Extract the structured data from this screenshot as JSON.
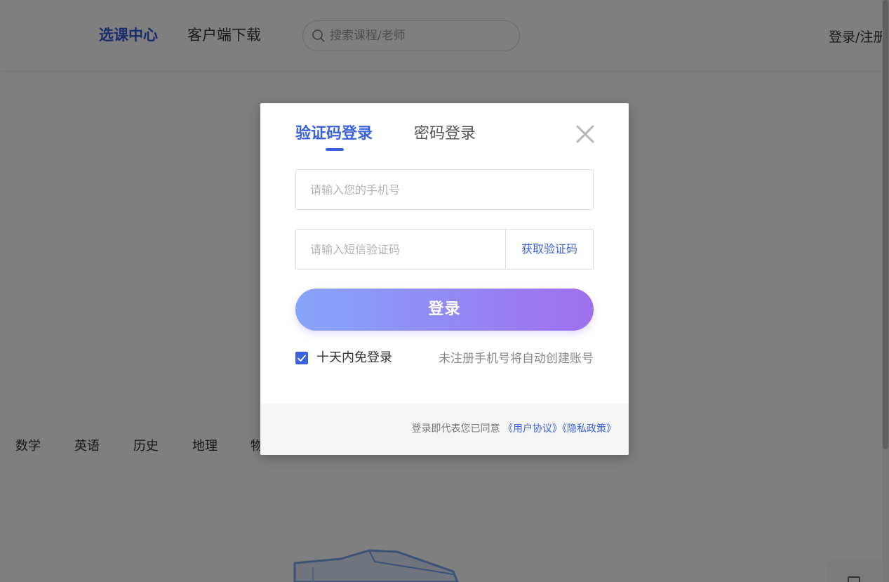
{
  "header": {
    "nav": {
      "course_center": "选课中心",
      "client_download": "客户端下载"
    },
    "search": {
      "placeholder": "搜索课程/老师"
    },
    "login_register": "登录/注册"
  },
  "subjects": [
    "数学",
    "英语",
    "历史",
    "地理",
    "物"
  ],
  "modal": {
    "tabs": {
      "sms": "验证码登录",
      "password": "密码登录"
    },
    "phone_placeholder": "请输入您的手机号",
    "code_placeholder": "请输入短信验证码",
    "get_code": "获取验证码",
    "login_button": "登录",
    "remember_label": "十天内免登录",
    "remember_checked": true,
    "auto_register_note": "未注册手机号将自动创建账号",
    "agreement": {
      "prefix": "登录即代表您已同意",
      "user_agreement": "《用户协议》",
      "privacy_policy": "《隐私政策》"
    }
  },
  "colors": {
    "accent": "#3a62de",
    "nav_active": "#3558d8",
    "button_gradient_start": "#86a5f9",
    "button_gradient_end": "#9f6fed",
    "overlay": "rgba(0,0,0,0.5)"
  }
}
